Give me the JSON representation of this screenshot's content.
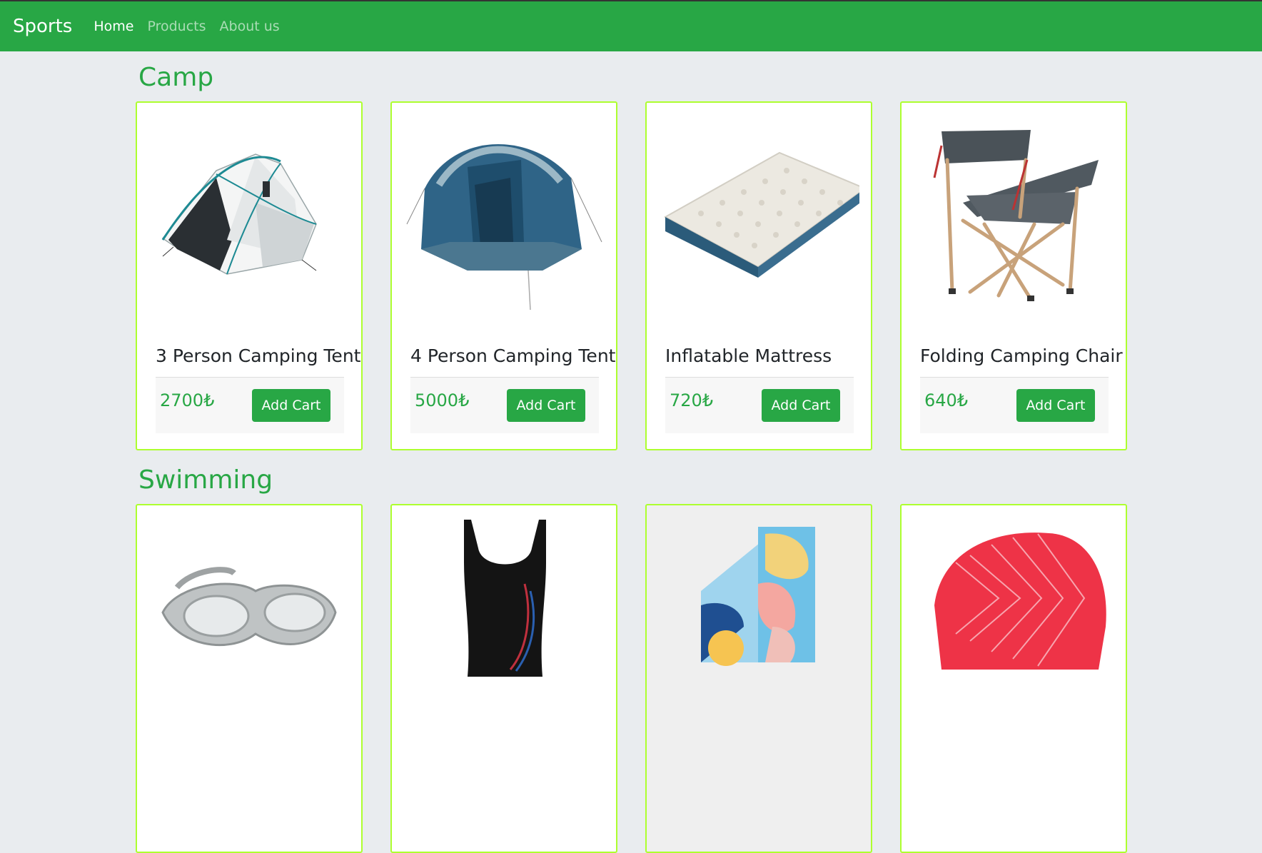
{
  "navbar": {
    "brand": "Sports",
    "links": [
      "Home",
      "Products",
      "About us"
    ]
  },
  "sections": [
    {
      "title": "Camp",
      "products": [
        {
          "name": "3 Person Camping Tent",
          "price": "2700₺",
          "button": "Add Cart"
        },
        {
          "name": "4 Person Camping Tent",
          "price": "5000₺",
          "button": "Add Cart"
        },
        {
          "name": "Inflatable Mattress",
          "price": "720₺",
          "button": "Add Cart"
        },
        {
          "name": "Folding Camping Chair",
          "price": "640₺",
          "button": "Add Cart"
        }
      ]
    },
    {
      "title": "Swimming",
      "products": []
    }
  ],
  "colors": {
    "brand_green": "#28a745",
    "card_border": "#adff2f",
    "page_background": "#e9ecef"
  }
}
